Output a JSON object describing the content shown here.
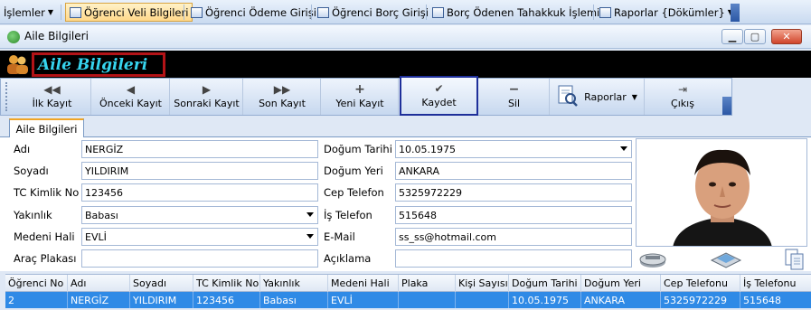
{
  "menubar": {
    "items": [
      {
        "label": "İşlemler"
      },
      {
        "label": "Öğrenci Veli Bilgileri"
      },
      {
        "label": "Öğrenci Ödeme Girişi"
      },
      {
        "label": "Öğrenci Borç Girişi"
      },
      {
        "label": "Borç Ödenen Tahakkuk İşlemi"
      },
      {
        "label": "Raporlar {Dökümler}"
      }
    ]
  },
  "window": {
    "title": "Aile Bilgileri",
    "header_title": "Aile Bilgileri"
  },
  "toolbar": {
    "first": "İlk Kayıt",
    "prev": "Önceki Kayıt",
    "next": "Sonraki Kayıt",
    "last": "Son Kayıt",
    "new": "Yeni Kayıt",
    "save": "Kaydet",
    "delete": "Sil",
    "reports": "Raporlar",
    "exit": "Çıkış"
  },
  "tab": {
    "label": "Aile Bilgileri"
  },
  "form": {
    "adi": {
      "label": "Adı",
      "value": "NERGİZ"
    },
    "soyadi": {
      "label": "Soyadı",
      "value": "YILDIRIM"
    },
    "tc": {
      "label": "TC Kimlik No",
      "value": "123456"
    },
    "yakinlik": {
      "label": "Yakınlık",
      "value": "Babası"
    },
    "medeni": {
      "label": "Medeni Hali",
      "value": "EVLİ"
    },
    "plaka": {
      "label": "Araç Plakası",
      "value": ""
    },
    "dogum_tarihi": {
      "label": "Doğum Tarihi",
      "value": "10.05.1975"
    },
    "dogum_yeri": {
      "label": "Doğum Yeri",
      "value": "ANKARA"
    },
    "cep": {
      "label": "Cep Telefon",
      "value": "5325972229"
    },
    "is_tel": {
      "label": "İş Telefon",
      "value": "515648"
    },
    "email": {
      "label": "E-Mail",
      "value": "ss_ss@hotmail.com"
    },
    "aciklama": {
      "label": "Açıklama",
      "value": ""
    }
  },
  "grid": {
    "headers": [
      "Öğrenci No",
      "Adı",
      "Soyadı",
      "TC Kimlik No",
      "Yakınlık",
      "Medeni Hali",
      "Plaka",
      "Kişi Sayısı",
      "Doğum Tarihi",
      "Doğum Yeri",
      "Cep Telefonu",
      "İş Telefonu"
    ],
    "rows": [
      [
        "2",
        "NERGİZ",
        "YILDIRIM",
        "123456",
        "Babası",
        "EVLİ",
        "",
        "",
        "10.05.1975",
        "ANKARA",
        "5325972229",
        "515648"
      ]
    ]
  },
  "colors": {
    "accent": "#2f8ae6",
    "header_title": "#36d4ee",
    "highlight_border": "#b31317"
  }
}
